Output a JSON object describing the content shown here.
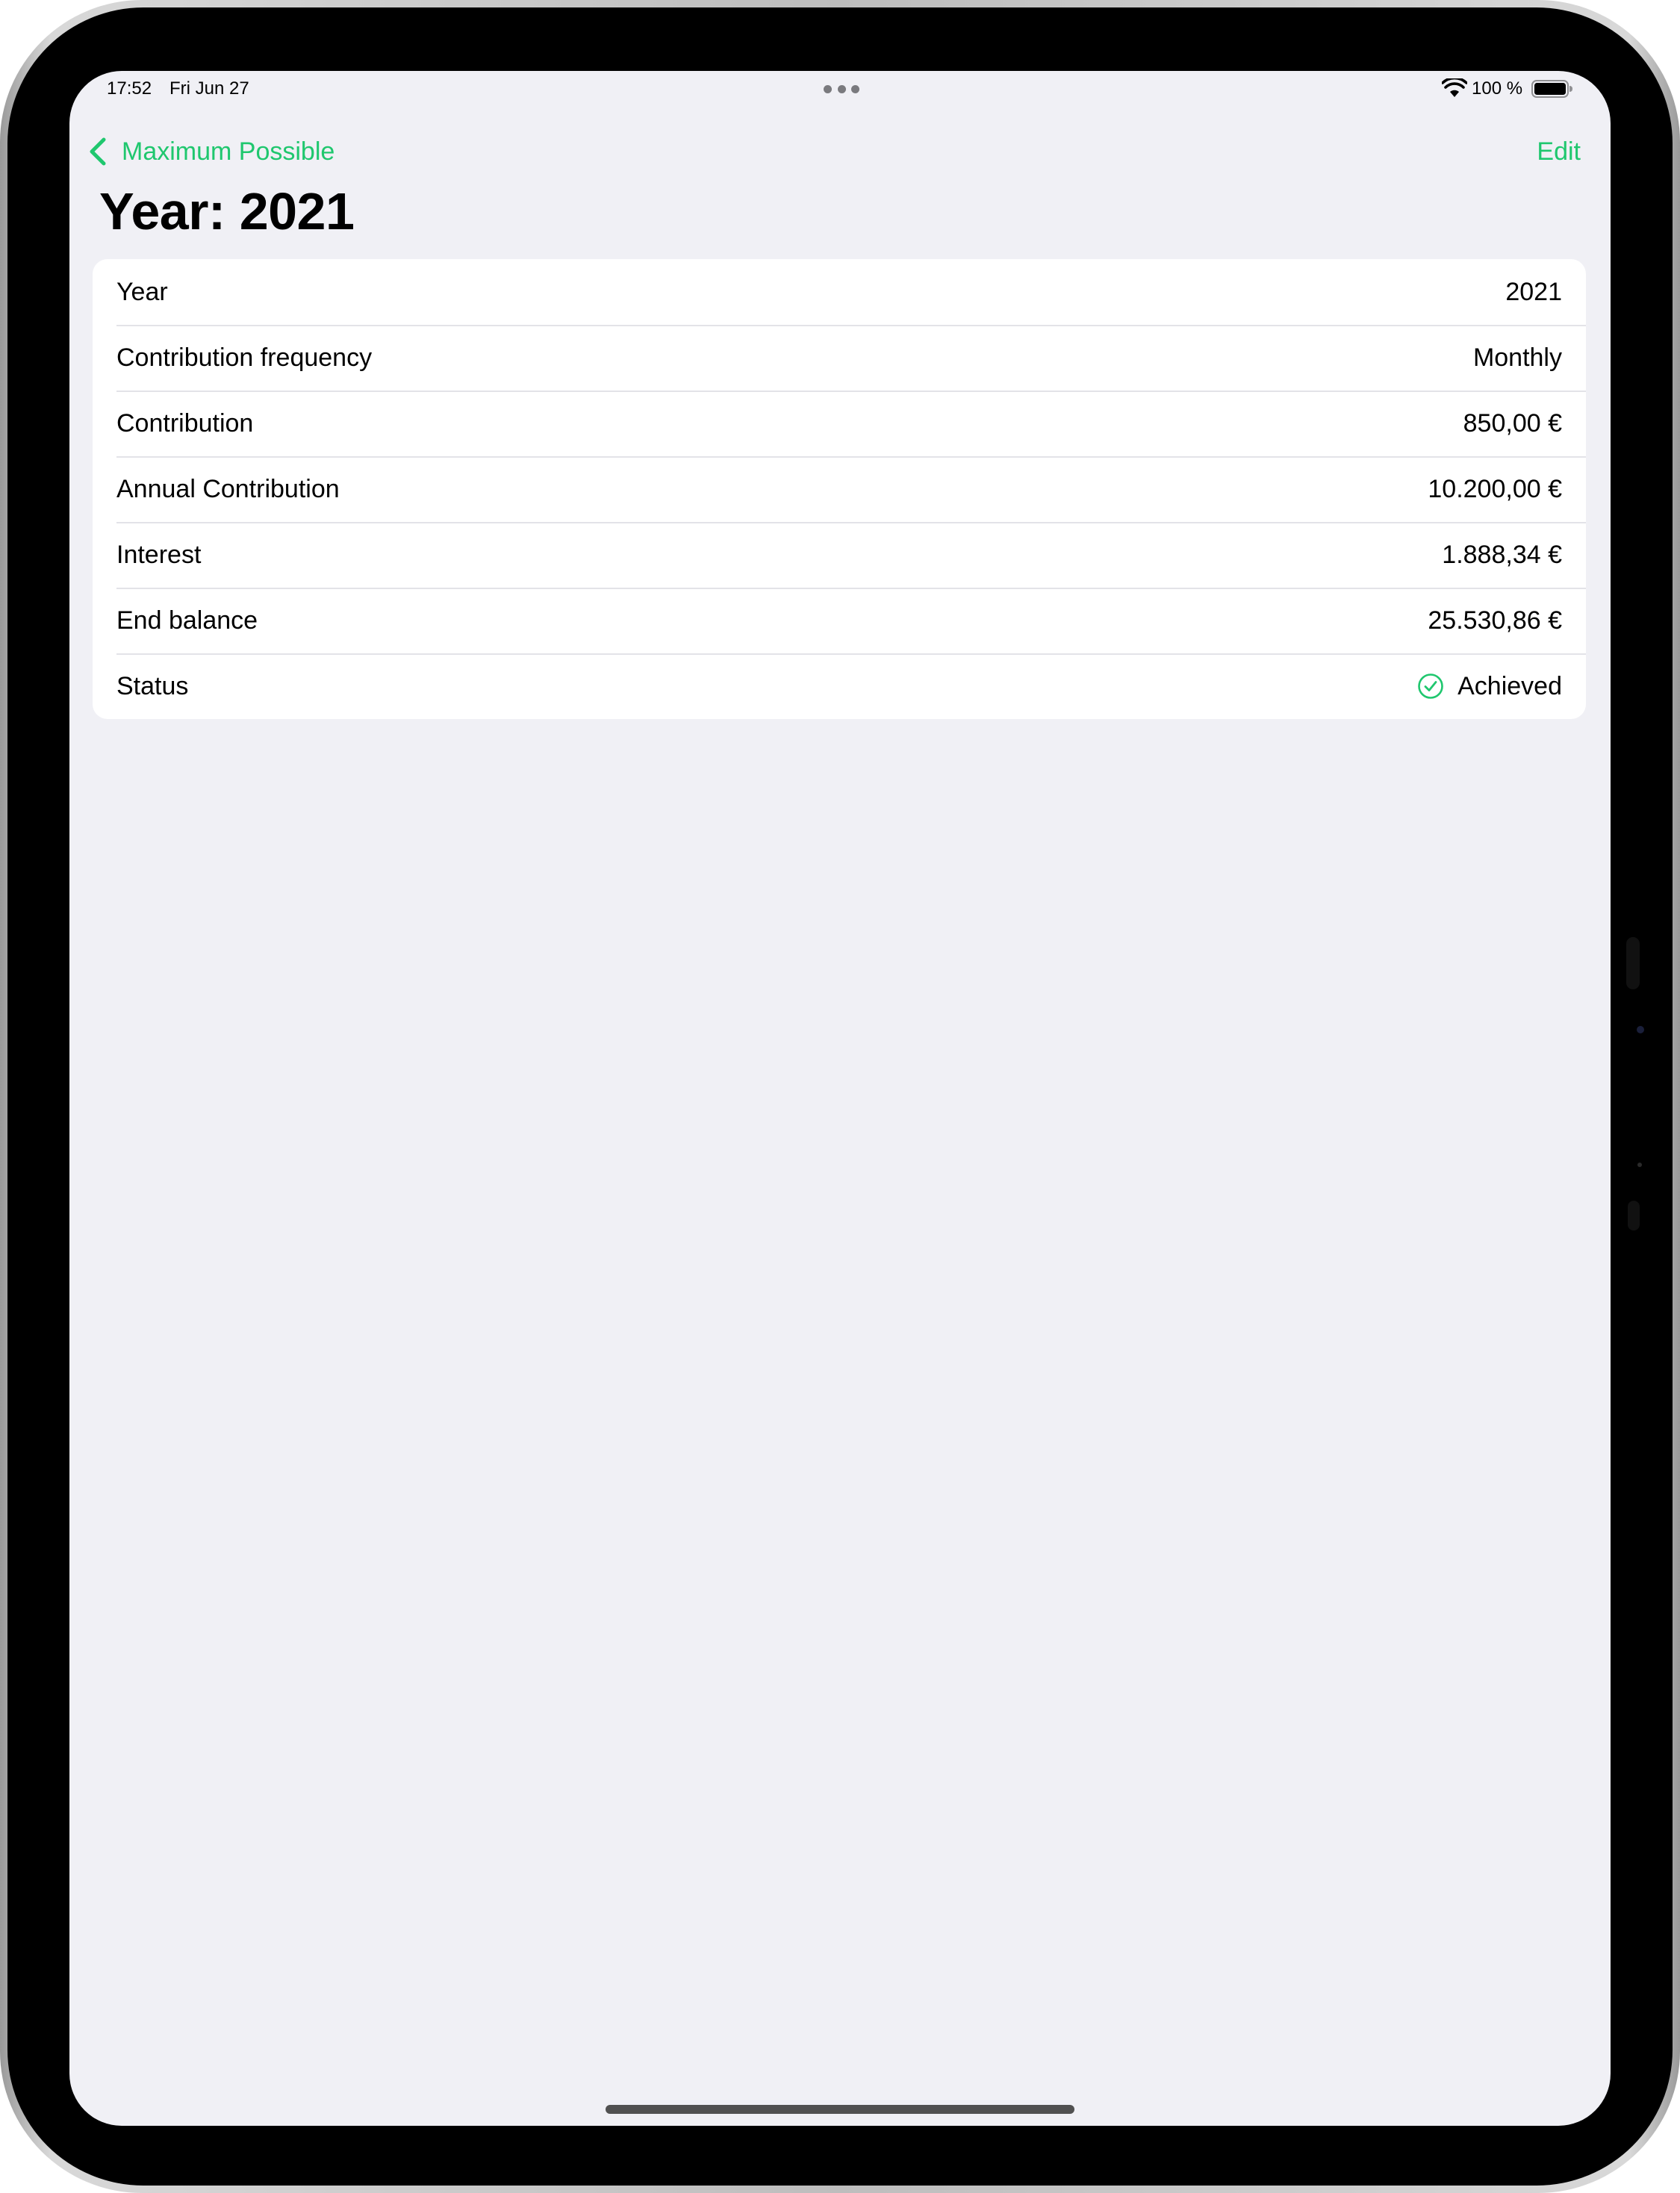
{
  "status_bar": {
    "time": "17:52",
    "date": "Fri Jun 27",
    "battery_percent": "100 %",
    "wifi_icon": "wifi-icon",
    "battery_icon": "battery-full-icon",
    "multitask_icon": "ellipsis-icon"
  },
  "nav": {
    "back_label": "Maximum Possible",
    "back_icon": "chevron-left-icon",
    "edit_label": "Edit",
    "accent_color": "#1fc76e"
  },
  "page": {
    "title": "Year: 2021"
  },
  "details": {
    "rows": [
      {
        "label": "Year",
        "value": "2021"
      },
      {
        "label": "Contribution frequency",
        "value": "Monthly"
      },
      {
        "label": "Contribution",
        "value": "850,00 €"
      },
      {
        "label": "Annual Contribution",
        "value": "10.200,00 €"
      },
      {
        "label": "Interest",
        "value": "1.888,34 €"
      },
      {
        "label": "End balance",
        "value": "25.530,86 €"
      },
      {
        "label": "Status",
        "value": "Achieved",
        "icon": "checkmark-circle-icon"
      }
    ]
  },
  "colors": {
    "background": "#f0f0f5",
    "card": "#ffffff",
    "accent": "#1fc76e"
  }
}
